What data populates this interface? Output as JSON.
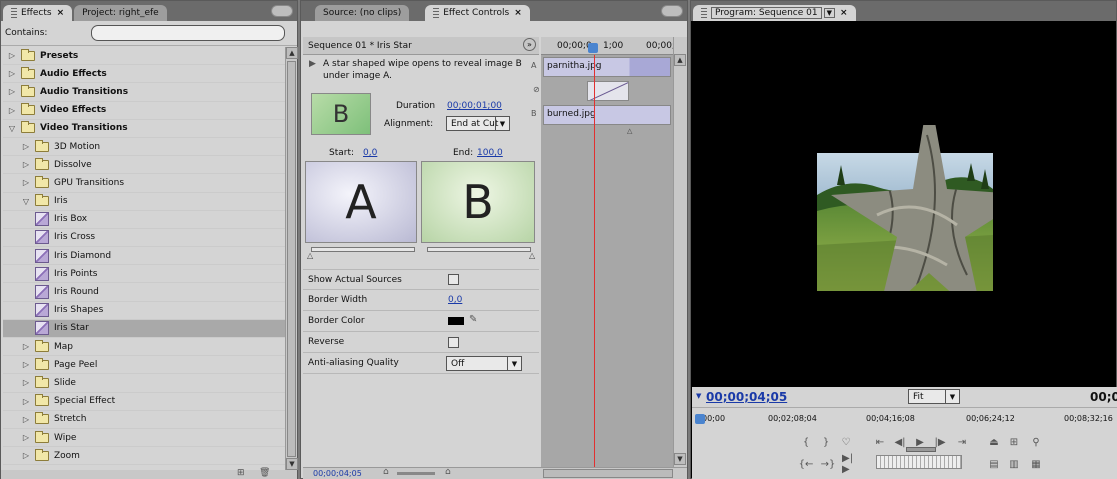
{
  "effects_panel": {
    "tabs": [
      "Effects",
      "Project: right_efe"
    ],
    "contains_label": "Contains:",
    "search_value": "",
    "tree": [
      {
        "label": "Presets",
        "level": 0,
        "kind": "preset-folder",
        "expanded": false,
        "bold": true
      },
      {
        "label": "Audio Effects",
        "level": 0,
        "kind": "folder",
        "expanded": false,
        "bold": true
      },
      {
        "label": "Audio Transitions",
        "level": 0,
        "kind": "folder",
        "expanded": false,
        "bold": true
      },
      {
        "label": "Video Effects",
        "level": 0,
        "kind": "folder",
        "expanded": false,
        "bold": true
      },
      {
        "label": "Video Transitions",
        "level": 0,
        "kind": "folder",
        "expanded": true,
        "bold": true
      },
      {
        "label": "3D Motion",
        "level": 1,
        "kind": "folder",
        "expanded": false
      },
      {
        "label": "Dissolve",
        "level": 1,
        "kind": "folder",
        "expanded": false
      },
      {
        "label": "GPU Transitions",
        "level": 1,
        "kind": "folder",
        "expanded": false
      },
      {
        "label": "Iris",
        "level": 1,
        "kind": "folder",
        "expanded": true
      },
      {
        "label": "Iris Box",
        "level": 2,
        "kind": "effect"
      },
      {
        "label": "Iris Cross",
        "level": 2,
        "kind": "effect"
      },
      {
        "label": "Iris Diamond",
        "level": 2,
        "kind": "effect"
      },
      {
        "label": "Iris Points",
        "level": 2,
        "kind": "effect"
      },
      {
        "label": "Iris Round",
        "level": 2,
        "kind": "effect"
      },
      {
        "label": "Iris Shapes",
        "level": 2,
        "kind": "effect"
      },
      {
        "label": "Iris Star",
        "level": 2,
        "kind": "effect",
        "selected": true
      },
      {
        "label": "Map",
        "level": 1,
        "kind": "folder",
        "expanded": false
      },
      {
        "label": "Page Peel",
        "level": 1,
        "kind": "folder",
        "expanded": false
      },
      {
        "label": "Slide",
        "level": 1,
        "kind": "folder",
        "expanded": false
      },
      {
        "label": "Special Effect",
        "level": 1,
        "kind": "folder",
        "expanded": false
      },
      {
        "label": "Stretch",
        "level": 1,
        "kind": "folder",
        "expanded": false
      },
      {
        "label": "Wipe",
        "level": 1,
        "kind": "folder",
        "expanded": false
      },
      {
        "label": "Zoom",
        "level": 1,
        "kind": "folder",
        "expanded": false
      }
    ]
  },
  "effect_controls": {
    "tabs": [
      "Source: (no clips)",
      "Effect Controls"
    ],
    "header": "Sequence 01 * Iris Star",
    "description": "A star shaped wipe opens to reveal image B under image A.",
    "thumb_letter": "B",
    "duration_label": "Duration",
    "duration_value": "00;00;01;00",
    "alignment_label": "Alignment:",
    "alignment_value": "End at Cut",
    "start_label": "Start:",
    "start_value": "0,0",
    "end_label": "End:",
    "end_value": "100,0",
    "preview_a": "A",
    "preview_b": "B",
    "props": {
      "show_actual_sources": "Show Actual Sources",
      "border_width": "Border Width",
      "border_width_value": "0,0",
      "border_color": "Border Color",
      "reverse": "Reverse",
      "anti_aliasing": "Anti-aliasing Quality",
      "anti_aliasing_value": "Off"
    },
    "timeline": {
      "time_left": "00;00;0",
      "time_right": "00;00;",
      "playhead_suffix": "1;00",
      "track_a_label": "A",
      "track_b_label": "B",
      "clip_a": "parnitha.jpg",
      "clip_b": "burned.jpg"
    },
    "footer_time": "00;00;04;05"
  },
  "program_monitor": {
    "tab": "Program: Sequence 01",
    "current_time": "00;00;04;05",
    "fit_value": "Fit",
    "duration_time": "00;00;",
    "ruler": [
      "00;00",
      "00;02;08;04",
      "00;04;16;08",
      "00;06;24;12",
      "00;08;32;16"
    ],
    "colors": {
      "timecode": "#1a3aa8",
      "playhead": "#e23030"
    }
  }
}
